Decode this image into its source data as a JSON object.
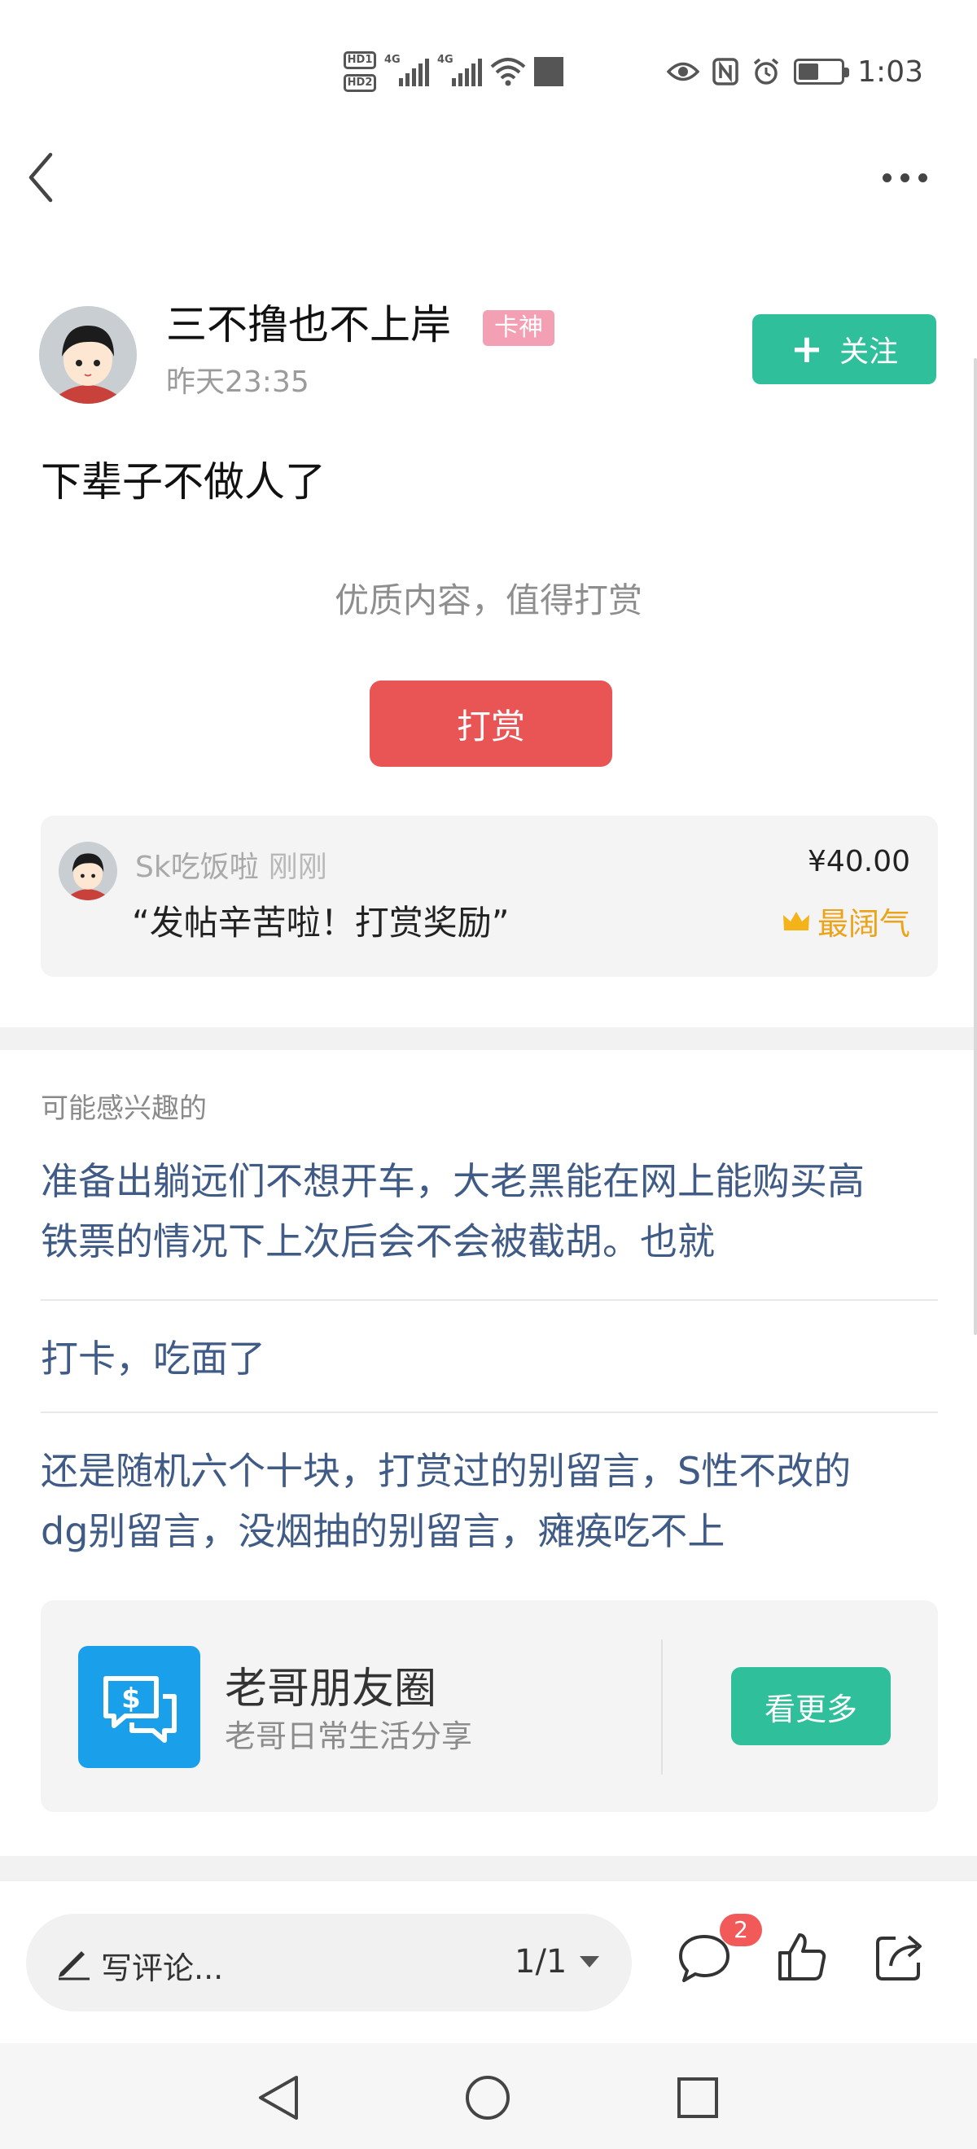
{
  "status_bar": {
    "time": "1:03",
    "sim1": "1",
    "sim2": "2",
    "network": "4G"
  },
  "post": {
    "author": {
      "name": "三不撸也不上岸",
      "badge": "卡神",
      "time": "昨天23:35"
    },
    "follow_label": "关注",
    "body": "下辈子不做人了",
    "reward_hint": "优质内容，值得打赏",
    "reward_button": "打赏"
  },
  "tip": {
    "user": "Sk吃饭啦",
    "when": "刚刚",
    "message": "“发帖辛苦啦！打赏奖励”",
    "amount": "¥40.00",
    "title": "最阔气"
  },
  "related": {
    "label": "可能感兴趣的",
    "items": [
      {
        "line1": "准备出躺远们不想开车，大老黑能在网上能购买高",
        "line2": "铁票的情况下上次后会不会被截胡。也就"
      },
      {
        "line1": "打卡，吃面了",
        "line2": ""
      },
      {
        "line1": "还是随机六个十块，打赏过的别留言，S性不改的",
        "line2": "dg别留言，没烟抽的别留言，瘫痪吃不上"
      }
    ]
  },
  "circle": {
    "name": "老哥朋友圈",
    "desc": "老哥日常生活分享",
    "button": "看更多"
  },
  "bottom": {
    "comment_placeholder": "写评论...",
    "pager": "1/1",
    "comment_count": "2"
  },
  "colors": {
    "accent_green": "#2fbf9b",
    "reward_red": "#e95454",
    "link_blue": "#3f5b86",
    "badge_pink": "#f39fb4",
    "gold": "#eda318"
  },
  "icons": [
    "back-icon",
    "more-icon",
    "plus-icon",
    "crown-icon",
    "chat-money-icon",
    "pen-icon",
    "caret-down-icon",
    "comment-icon",
    "like-icon",
    "share-icon",
    "nav-back-icon",
    "nav-home-icon",
    "nav-recents-icon"
  ]
}
